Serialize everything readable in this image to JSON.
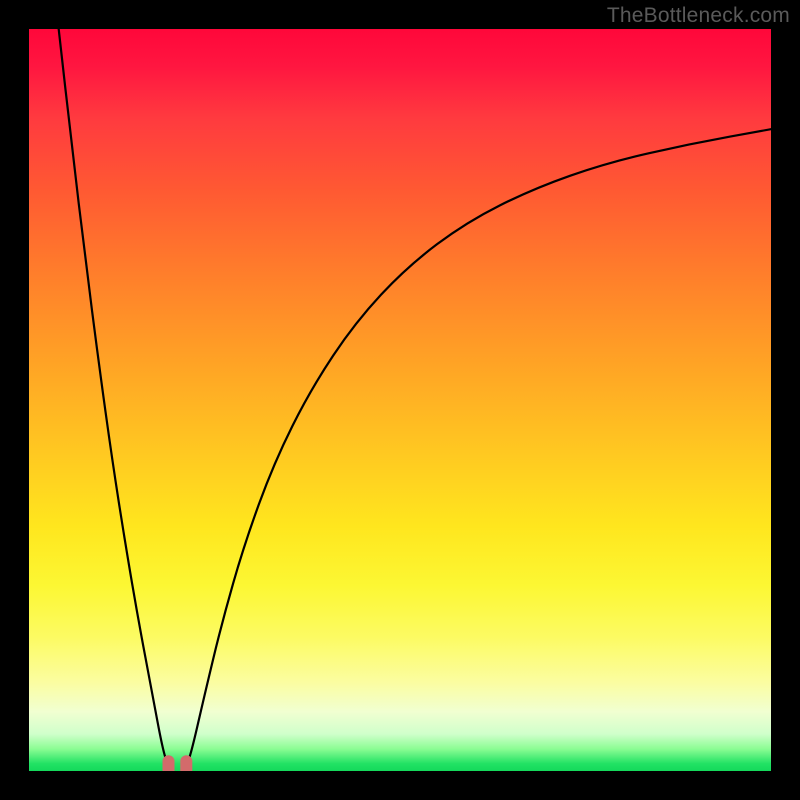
{
  "watermark": "TheBottleneck.com",
  "chart_data": {
    "type": "line",
    "title": "",
    "xlabel": "",
    "ylabel": "",
    "xlim": [
      0,
      100
    ],
    "ylim": [
      0,
      100
    ],
    "grid": false,
    "legend": false,
    "background": {
      "type": "vertical_gradient",
      "stops": [
        {
          "pos": 0.0,
          "color": "#ff073a"
        },
        {
          "pos": 0.12,
          "color": "#ff3a3f"
        },
        {
          "pos": 0.33,
          "color": "#ff7e2b"
        },
        {
          "pos": 0.57,
          "color": "#ffc821"
        },
        {
          "pos": 0.75,
          "color": "#fcf733"
        },
        {
          "pos": 0.92,
          "color": "#f1ffd1"
        },
        {
          "pos": 0.97,
          "color": "#8cfd94"
        },
        {
          "pos": 1.0,
          "color": "#14d95b"
        }
      ]
    },
    "series": [
      {
        "name": "left-branch",
        "x": [
          4.0,
          5.8,
          7.6,
          9.4,
          11.2,
          13.0,
          14.8,
          16.6,
          18.0,
          18.8
        ],
        "y": [
          100,
          84.0,
          69.0,
          55.0,
          42.0,
          30.5,
          20.0,
          10.5,
          3.0,
          0.5
        ],
        "stroke": "#000000",
        "stroke_width": 2.2
      },
      {
        "name": "right-branch",
        "x": [
          21.2,
          22.0,
          23.6,
          26.0,
          29.0,
          33.0,
          38.0,
          44.0,
          51.0,
          59.0,
          68.0,
          78.0,
          89.0,
          100.0
        ],
        "y": [
          0.5,
          3.0,
          10.0,
          20.0,
          30.5,
          41.5,
          51.5,
          60.5,
          68.0,
          74.0,
          78.5,
          82.0,
          84.5,
          86.5
        ],
        "stroke": "#000000",
        "stroke_width": 2.2
      },
      {
        "name": "bottom-marker",
        "shape": "u",
        "x": [
          18.8,
          21.2
        ],
        "y": [
          0.5,
          0.5
        ],
        "stroke": "#d36b6b",
        "stroke_width": 12,
        "depth_y": 3.2
      }
    ]
  }
}
